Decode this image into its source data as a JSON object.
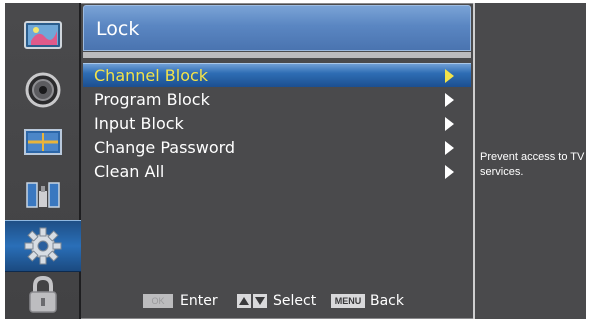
{
  "header": {
    "title": "Lock"
  },
  "sidebar": {
    "items": [
      {
        "icon": "picture-icon",
        "active": false
      },
      {
        "icon": "speaker-icon",
        "active": false
      },
      {
        "icon": "tv-channel-icon",
        "active": false
      },
      {
        "icon": "input-icon",
        "active": false
      },
      {
        "icon": "gear-icon",
        "active": true
      },
      {
        "icon": "lock-icon",
        "active": false
      }
    ]
  },
  "menu": {
    "items": [
      {
        "label": "Channel Block",
        "selected": true
      },
      {
        "label": "Program Block",
        "selected": false
      },
      {
        "label": "Input Block",
        "selected": false
      },
      {
        "label": "Change Password",
        "selected": false
      },
      {
        "label": "Clean All",
        "selected": false
      }
    ]
  },
  "help": {
    "text": "Prevent access to TV services."
  },
  "hints": {
    "ok_key": "OK",
    "enter_label": "Enter",
    "select_label": "Select",
    "menu_key": "MENU",
    "back_label": "Back"
  },
  "colors": {
    "panel": "#4a4a4c",
    "selection": "#2e6db4",
    "selected_text": "#f3e34a",
    "header": "#5a86c2"
  }
}
